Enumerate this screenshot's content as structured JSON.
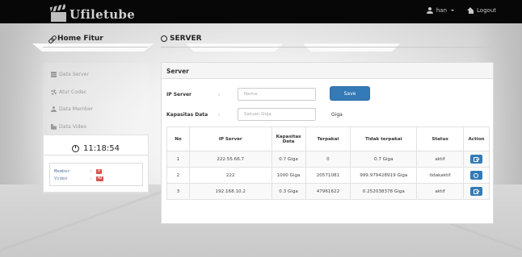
{
  "app": {
    "brand": "Ufiletube"
  },
  "nav": {
    "user_label": "han",
    "logout_label": "Logout"
  },
  "headings": {
    "home": "Home Fitur",
    "server": "SERVER"
  },
  "sidebar": {
    "items": [
      {
        "label": "Data Server",
        "icon": "server-icon"
      },
      {
        "label": "Atur Codec",
        "icon": "gear-icon"
      },
      {
        "label": "Data Member",
        "icon": "member-icon"
      },
      {
        "label": "Data Video",
        "icon": "video-icon"
      }
    ],
    "clock": "11:18:54",
    "stats": [
      {
        "label": "Member",
        "colon": ":",
        "count": "3"
      },
      {
        "label": "Video",
        "colon": ":",
        "count": "42"
      }
    ]
  },
  "panel": {
    "title": "Server",
    "ip_label": "IP Server",
    "ip_colon": ":",
    "ip_placeholder": "Nama",
    "save_label": "Save",
    "capacity_label": "Kapasitas Data",
    "capacity_colon": ":",
    "capacity_placeholder": "Satuan Giga",
    "unit_label": "Giga"
  },
  "table": {
    "headers": [
      "No",
      "IP Server",
      "Kapasitas Data",
      "Terpakai",
      "Tidak terpakai",
      "Status",
      "Action"
    ],
    "rows": [
      {
        "no": "1",
        "ip": "222.55.66.7",
        "cap": "0.7 Giga",
        "used": "0",
        "free": "0.7 Giga",
        "status": "aktif",
        "action_icon": "edit-icon"
      },
      {
        "no": "2",
        "ip": "222",
        "cap": "1000 Giga",
        "used": "20571081",
        "free": "999.979428919 Giga",
        "status": "tidakaktif",
        "action_icon": "circle-icon"
      },
      {
        "no": "3",
        "ip": "192.168.10.2",
        "cap": "0.3 Giga",
        "used": "47961622",
        "free": "0.252038378 Giga",
        "status": "aktif",
        "action_icon": "edit-icon"
      }
    ]
  },
  "colors": {
    "navbar": "#070707",
    "primary": "#337ab7",
    "badge": "#d9534f"
  }
}
